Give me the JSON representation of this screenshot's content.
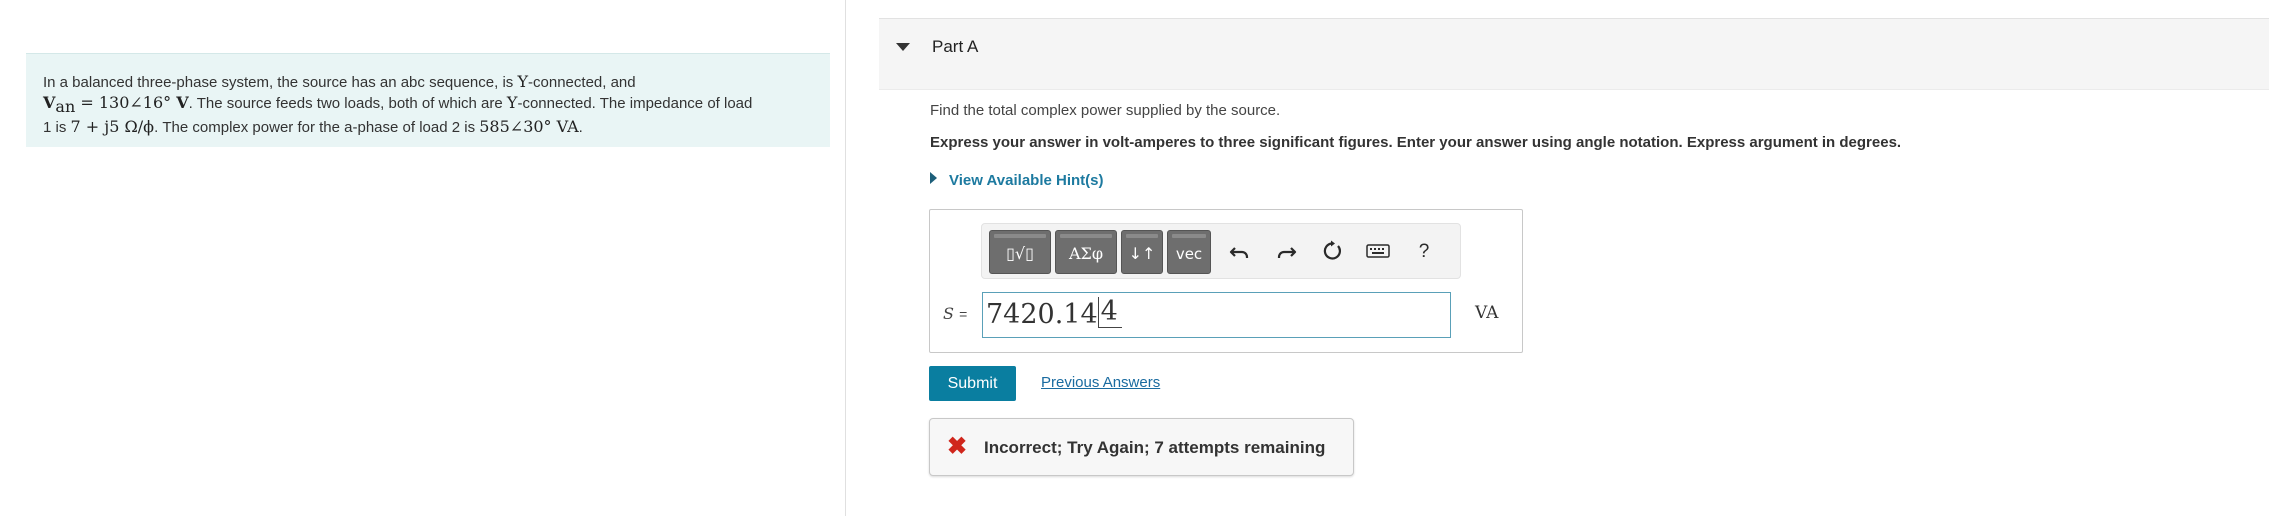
{
  "problem": {
    "t1": "In a balanced three-phase system, the source has an abc sequence, is ",
    "Y": "Y",
    "t2": "-connected, and",
    "V": "V",
    "an": "an",
    "eq1": " = 130∠16° ",
    "Vunit": "V",
    "t3": ". The source feeds two loads, both of which are ",
    "t4": "-connected. The impedance of load",
    "t5": "1 is ",
    "imp": "7 + j5 Ω/ϕ",
    "t6": ". The complex power for the a-phase of load 2 is ",
    "pow": "585∠30° VA",
    "t7": "."
  },
  "part": {
    "title": "Part A"
  },
  "question": "Find the total complex power supplied by the source.",
  "instructions": "Express your answer in volt-amperes to three significant figures. Enter your answer using angle notation. Express argument in degrees.",
  "hints_label": "View Available Hint(s)",
  "toolbar": {
    "templates": "▯√▯",
    "greek": "ΑΣφ",
    "arrows": "↓↑",
    "vec": "vec",
    "help": "?"
  },
  "answer": {
    "var": "S",
    "eq": "=",
    "magnitude": "7420.14",
    "angle": "4",
    "unit": "VA"
  },
  "submit_label": "Submit",
  "previous_answers_label": "Previous Answers",
  "feedback": {
    "icon": "✖",
    "message": "Incorrect; Try Again; 7 attempts remaining"
  },
  "colors": {
    "accent": "#0a7ea0",
    "link": "#1a6ba0",
    "error": "#d0261c",
    "problem_bg": "#e9f5f5"
  }
}
